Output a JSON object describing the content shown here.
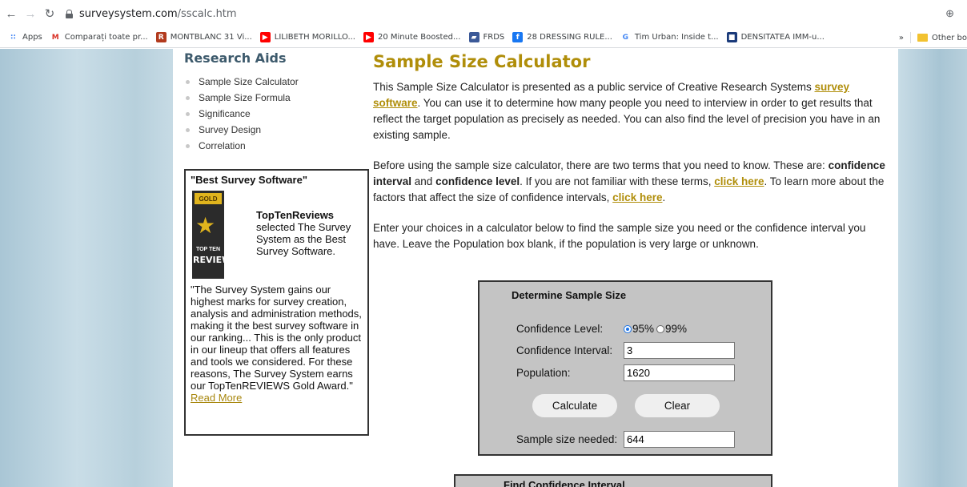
{
  "browser": {
    "url_host": "surveysystem.com",
    "url_path": "/sscalc.htm",
    "bookmarks": [
      {
        "label": "Apps",
        "icon": "apps-grid-icon",
        "color": "#4285f4"
      },
      {
        "label": "Comparați toate pr...",
        "icon": "gmail-icon",
        "color": "#d93025"
      },
      {
        "label": "MONTBLANC 31 Vi...",
        "icon": "r-logo-icon",
        "color": "#b23a1d"
      },
      {
        "label": "LILIBETH MORILLO...",
        "icon": "youtube-icon",
        "color": "#ff0000"
      },
      {
        "label": "20 Minute Boosted...",
        "icon": "youtube-icon",
        "color": "#ff0000"
      },
      {
        "label": "FRDS",
        "icon": "frds-icon",
        "color": "#3b5998"
      },
      {
        "label": "28 DRESSING RULE...",
        "icon": "facebook-icon",
        "color": "#1877f2"
      },
      {
        "label": "Tim Urban: Inside t...",
        "icon": "google-icon",
        "color": "#4285f4"
      },
      {
        "label": "DENSITATEA IMM-u...",
        "icon": "densitatea-icon",
        "color": "#1a3a7a"
      }
    ],
    "overflow": "»",
    "other_bookmarks": "Other bo"
  },
  "sidebar": {
    "heading": "Research Aids",
    "items": [
      {
        "label": "Sample Size Calculator"
      },
      {
        "label": "Sample Size Formula"
      },
      {
        "label": "Significance"
      },
      {
        "label": "Survey Design"
      },
      {
        "label": "Correlation"
      }
    ]
  },
  "award": {
    "title": "\"Best Survey Software\"",
    "badge_gold": "GOLD",
    "badge_top": "TOP TEN",
    "badge_reviews": "REVIEWS",
    "org": "TopTenReviews",
    "line": "selected The Survey System as the Best Survey Software.",
    "quote": "\"The Survey System gains our highest marks for survey creation, analysis and administration methods, making it the best survey software in our ranking... This is the only product in our lineup that offers all features and tools we considered. For these reasons, The Survey System earns our TopTenREVIEWS Gold Award.\"",
    "read_more": "Read More"
  },
  "main": {
    "title": "Sample Size Calculator",
    "p1_a": "This Sample Size Calculator is presented as a public service of Creative Research Systems ",
    "p1_link": "survey software",
    "p1_b": ". You can use it to determine how many people you need to interview in order to get results that reflect the target population as precisely as needed. You can also find the level of precision you have in an existing sample.",
    "p2_a": "Before using the sample size calculator, there are two terms that you need to know. These are: ",
    "p2_term1": "confidence interval",
    "p2_and": " and ",
    "p2_term2": "confidence level",
    "p2_b": ". If you are not familiar with these terms, ",
    "p2_link1": "click here",
    "p2_c": ". To learn more about the factors that affect the size of confidence intervals, ",
    "p2_link2": "click here",
    "p2_d": ".",
    "p3": "Enter your choices in a calculator below to find the sample size you need or the confidence interval you have. Leave the Population box blank, if the population is very large or unknown."
  },
  "calculator": {
    "title": "Determine Sample Size",
    "confidence_level_label": "Confidence Level:",
    "opt95": "95%",
    "opt99": "99%",
    "confidence_interval_label": "Confidence Interval:",
    "confidence_interval_value": "3",
    "population_label": "Population:",
    "population_value": "1620",
    "calculate": "Calculate",
    "clear": "Clear",
    "sample_label": "Sample size needed:",
    "sample_value": "644"
  },
  "calculator2": {
    "title": "Find Confidence Interval"
  }
}
